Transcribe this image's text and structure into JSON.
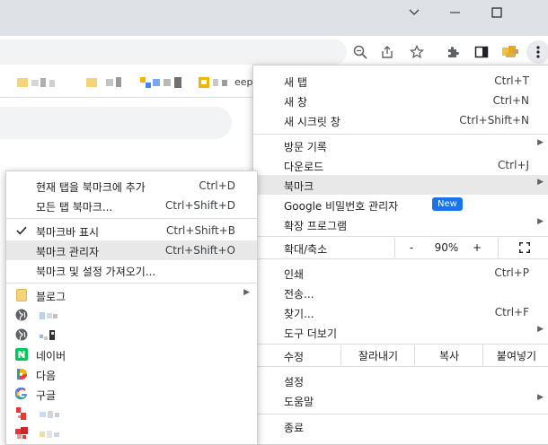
{
  "colors": {
    "titlebar": "#dee1e6",
    "highlight": "#e8e8e8",
    "badge": "#1a73e8",
    "naver": "#03c75a"
  },
  "window": {
    "controls": [
      "chevron-down-icon",
      "minimize-icon",
      "maximize-icon"
    ]
  },
  "toolbar": {
    "icons": [
      "zoom-icon",
      "share-icon",
      "star-icon",
      "extensions-icon",
      "side-panel-icon",
      "profile-icon",
      "more-icon"
    ]
  },
  "bookmarks_bar": {
    "partial_text": "eep"
  },
  "main_menu": {
    "new_tab": {
      "label": "새 탭",
      "shortcut": "Ctrl+T"
    },
    "new_window": {
      "label": "새 창",
      "shortcut": "Ctrl+N"
    },
    "incognito": {
      "label": "새 시크릿 창",
      "shortcut": "Ctrl+Shift+N"
    },
    "history": {
      "label": "방문 기록"
    },
    "downloads": {
      "label": "다운로드",
      "shortcut": "Ctrl+J"
    },
    "bookmarks": {
      "label": "북마크"
    },
    "passwords": {
      "label": "Google 비밀번호 관리자",
      "badge": "New"
    },
    "extensions": {
      "label": "확장 프로그램"
    },
    "zoom": {
      "label": "확대/축소",
      "minus": "-",
      "value": "90%",
      "plus": "+"
    },
    "print": {
      "label": "인쇄",
      "shortcut": "Ctrl+P"
    },
    "cast": {
      "label": "전송..."
    },
    "find": {
      "label": "찾기...",
      "shortcut": "Ctrl+F"
    },
    "more_tools": {
      "label": "도구 더보기"
    },
    "edit": {
      "label": "수정",
      "cut": "잘라내기",
      "copy": "복사",
      "paste": "붙여넣기"
    },
    "settings": {
      "label": "설정"
    },
    "help": {
      "label": "도움말"
    },
    "exit": {
      "label": "종료"
    }
  },
  "bookmarks_submenu": {
    "add_tab": {
      "label": "현재 탭을 북마크에 추가",
      "shortcut": "Ctrl+D"
    },
    "add_all": {
      "label": "모든 탭 북마크...",
      "shortcut": "Ctrl+Shift+D"
    },
    "show_bar": {
      "label": "북마크바 표시",
      "shortcut": "Ctrl+Shift+B",
      "checked": true
    },
    "manager": {
      "label": "북마크 관리자",
      "shortcut": "Ctrl+Shift+O"
    },
    "import": {
      "label": "북마크 및 설정 가져오기..."
    },
    "items": [
      {
        "icon": "folder-icon",
        "label": "블로그",
        "has_submenu": true
      },
      {
        "icon": "globe-icon",
        "label": ""
      },
      {
        "icon": "globe-icon",
        "label": ""
      },
      {
        "icon": "naver-icon",
        "label": "네이버"
      },
      {
        "icon": "daum-icon",
        "label": "다음"
      },
      {
        "icon": "google-icon",
        "label": "구글"
      },
      {
        "icon": "site-red-icon",
        "label": ""
      },
      {
        "icon": "site-red-icon",
        "label": ""
      }
    ]
  }
}
